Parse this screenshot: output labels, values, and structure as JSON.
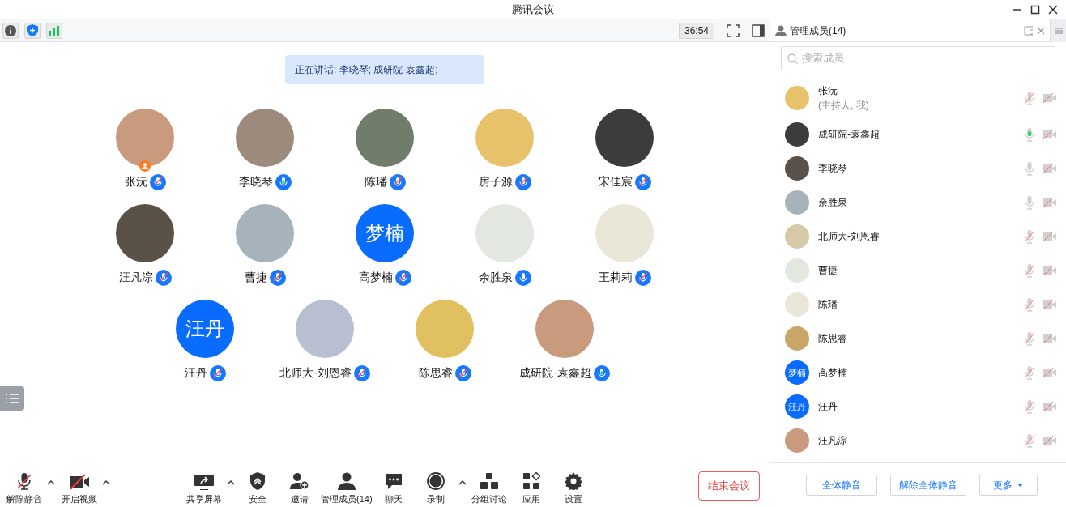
{
  "window": {
    "title": "腾讯会议"
  },
  "top_bar": {
    "timer": "36:54"
  },
  "speaking_banner": "正在讲话: 李晓琴; 成研院-袁鑫超;",
  "participants": [
    {
      "name": "张沅",
      "kind": "photo",
      "muted": true,
      "speaking": false,
      "host": true
    },
    {
      "name": "李晓琴",
      "kind": "photo",
      "muted": false,
      "speaking": true,
      "host": false
    },
    {
      "name": "陈璠",
      "kind": "photo",
      "muted": true,
      "speaking": false,
      "host": false
    },
    {
      "name": "房子源",
      "kind": "photo",
      "muted": true,
      "speaking": false,
      "host": false
    },
    {
      "name": "宋佳宸",
      "kind": "photo",
      "muted": true,
      "speaking": false,
      "host": false
    },
    {
      "name": "汪凡淙",
      "kind": "photo",
      "muted": true,
      "speaking": false,
      "host": false
    },
    {
      "name": "曹捷",
      "kind": "photo",
      "muted": true,
      "speaking": false,
      "host": false
    },
    {
      "name": "高梦楠",
      "kind": "initials",
      "initials": "梦楠",
      "muted": true,
      "speaking": false,
      "host": false
    },
    {
      "name": "余胜泉",
      "kind": "photo",
      "muted": false,
      "speaking": false,
      "host": false
    },
    {
      "name": "王莉莉",
      "kind": "photo",
      "muted": true,
      "speaking": false,
      "host": false
    },
    {
      "name": "汪丹",
      "kind": "initials",
      "initials": "汪丹",
      "muted": true,
      "speaking": false,
      "host": false
    },
    {
      "name": "北师大-刘恩睿",
      "kind": "photo",
      "muted": true,
      "speaking": false,
      "host": false
    },
    {
      "name": "陈思睿",
      "kind": "photo",
      "muted": true,
      "speaking": false,
      "host": false
    },
    {
      "name": "成研院-袁鑫超",
      "kind": "photo",
      "muted": false,
      "speaking": true,
      "host": false
    }
  ],
  "toolbar": {
    "left": [
      {
        "label": "解除静音",
        "caret": true
      },
      {
        "label": "开启视频",
        "caret": true
      }
    ],
    "center": [
      {
        "label": "共享屏幕",
        "caret": true
      },
      {
        "label": "安全",
        "caret": false
      },
      {
        "label": "邀请",
        "caret": false
      },
      {
        "label": "管理成员(14)",
        "caret": false
      },
      {
        "label": "聊天",
        "caret": false
      },
      {
        "label": "录制",
        "caret": true
      },
      {
        "label": "分组讨论",
        "caret": false
      },
      {
        "label": "应用",
        "caret": false
      },
      {
        "label": "设置",
        "caret": false
      }
    ],
    "end_button": "结束会议"
  },
  "members_panel": {
    "title": "管理成员(14)",
    "search": {
      "placeholder": "搜索成员"
    },
    "members": [
      {
        "name": "张沅",
        "subtitle": "(主持人, 我)",
        "kind": "photo",
        "muted": true,
        "speaking": false
      },
      {
        "name": "成研院-袁鑫超",
        "kind": "photo",
        "muted": false,
        "speaking": true
      },
      {
        "name": "李晓琴",
        "kind": "photo",
        "muted": false,
        "speaking": false
      },
      {
        "name": "余胜泉",
        "kind": "photo",
        "muted": false,
        "speaking": false
      },
      {
        "name": "北师大-刘恩睿",
        "kind": "photo",
        "muted": true,
        "speaking": false
      },
      {
        "name": "曹捷",
        "kind": "photo",
        "muted": true,
        "speaking": false
      },
      {
        "name": "陈璠",
        "kind": "photo",
        "muted": true,
        "speaking": false
      },
      {
        "name": "陈思睿",
        "kind": "photo",
        "muted": true,
        "speaking": false
      },
      {
        "name": "高梦楠",
        "kind": "initials",
        "initials": "梦楠",
        "muted": true,
        "speaking": false
      },
      {
        "name": "汪丹",
        "kind": "initials",
        "initials": "汪丹",
        "muted": true,
        "speaking": false
      },
      {
        "name": "汪凡淙",
        "kind": "photo",
        "muted": true,
        "speaking": false
      }
    ],
    "buttons": [
      "全体静音",
      "解除全体静音",
      "更多"
    ]
  }
}
